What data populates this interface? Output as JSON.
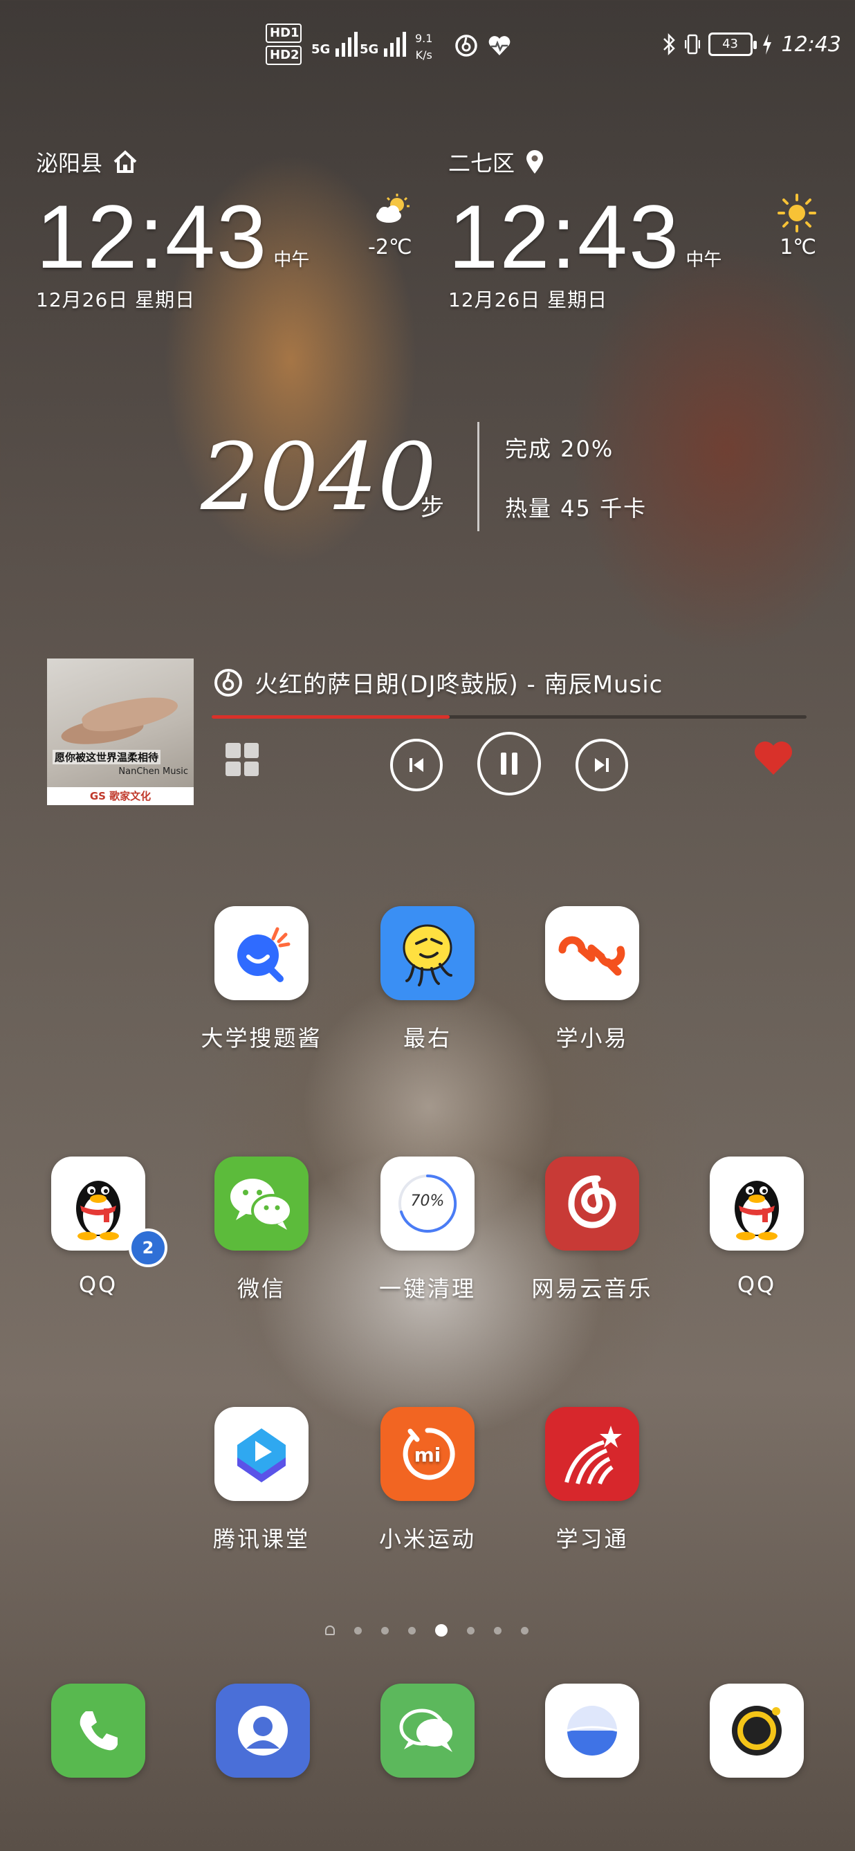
{
  "status_bar": {
    "hd1": "HD1",
    "hd2": "HD2",
    "net1": "5G",
    "net2": "5G",
    "speed_value": "9.1",
    "speed_unit": "K/s",
    "battery": "43",
    "time": "12:43"
  },
  "clock_left": {
    "city": "泌阳县",
    "time": "12:43",
    "ampm": "中午",
    "date": "12月26日 星期日",
    "temperature": "-2℃",
    "weather_icon": "partly-cloudy-icon"
  },
  "clock_right": {
    "city": "二七区",
    "time": "12:43",
    "ampm": "中午",
    "date": "12月26日 星期日",
    "temperature": "1℃",
    "weather_icon": "sunny-icon"
  },
  "steps": {
    "count": "2040",
    "unit": "步",
    "completion": "完成 20%",
    "calories": "热量 45 千卡"
  },
  "music": {
    "song": "火红的萨日朗(DJ咚鼓版) - 南辰Music",
    "cover_caption": "愿你被这世界温柔相待",
    "cover_artist": "NanChen Music",
    "cover_footer": "GS 歌家文化",
    "progress": 0.4,
    "liked_color": "#d9312a"
  },
  "apps": {
    "row1": [
      "大学搜题酱",
      "最右",
      "学小易"
    ],
    "row2": [
      "QQ",
      "微信",
      "一键清理",
      "网易云音乐",
      "QQ"
    ],
    "row3": [
      "腾讯课堂",
      "小米运动",
      "学习通"
    ],
    "cleaner_percent": "70%",
    "qq_badge": "2"
  },
  "dock": [
    "phone-icon",
    "contacts-icon",
    "messages-icon",
    "browser-icon",
    "camera-icon"
  ],
  "page_indicator": {
    "pages": 8,
    "active": 5
  }
}
